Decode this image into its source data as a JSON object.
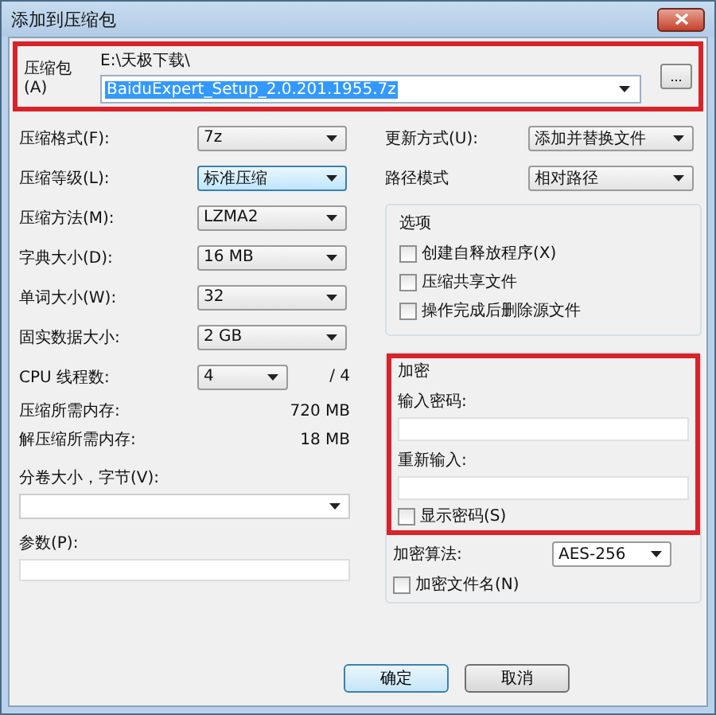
{
  "window": {
    "title": "添加到压缩包"
  },
  "archive": {
    "label": "压缩包(A)",
    "folder": "E:\\天极下载\\",
    "value": "BaiduExpert_Setup_2.0.201.1955.7z",
    "browse": "...",
    "highlighted": true
  },
  "settings": [
    {
      "kind": "select",
      "label": "压缩格式(F):",
      "value": "7z",
      "focused": false
    },
    {
      "kind": "select",
      "label": "压缩等级(L):",
      "value": "标准压缩",
      "focused": true
    },
    {
      "kind": "select",
      "label": "压缩方法(M):",
      "value": "LZMA2",
      "focused": false
    },
    {
      "kind": "select",
      "label": "字典大小(D):",
      "value": "16 MB",
      "focused": false
    },
    {
      "kind": "select",
      "label": "单词大小(W):",
      "value": "32",
      "focused": false
    },
    {
      "kind": "select",
      "label": "固实数据大小:",
      "value": "2 GB",
      "focused": false
    },
    {
      "kind": "threads",
      "label": "CPU 线程数:",
      "value": "4",
      "suffix": "/ 4",
      "focused": false
    },
    {
      "kind": "info",
      "label": "压缩所需内存:",
      "value": "720 MB"
    },
    {
      "kind": "info",
      "label": "解压缩所需内存:",
      "value": "18 MB"
    }
  ],
  "volume": {
    "label": "分卷大小，字节(V):"
  },
  "params": {
    "label": "参数(P):"
  },
  "right_selects": [
    {
      "label": "更新方式(U):",
      "value": "添加并替换文件"
    },
    {
      "label": "路径模式",
      "value": "相对路径"
    }
  ],
  "options": {
    "title": "选项",
    "items": [
      {
        "label": "创建自释放程序(X)",
        "checked": false
      },
      {
        "label": "压缩共享文件",
        "checked": false
      },
      {
        "label": "操作完成后删除源文件",
        "checked": false
      }
    ]
  },
  "encryption": {
    "title": "加密",
    "highlighted": true,
    "password_label": "输入密码:",
    "reenter_label": "重新输入:",
    "show_password": {
      "label": "显示密码(S)",
      "checked": false
    },
    "method_label": "加密算法:",
    "method": "AES-256",
    "encrypt_names": {
      "label": "加密文件名(N)",
      "checked": false
    }
  },
  "buttons": [
    {
      "label": "确定",
      "default": true
    },
    {
      "label": "取消",
      "default": false
    }
  ]
}
